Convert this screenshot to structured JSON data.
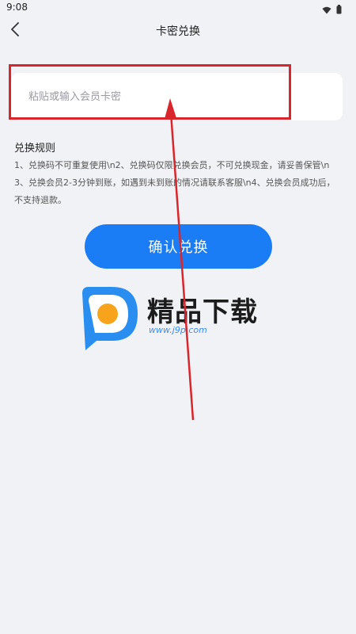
{
  "status_bar": {
    "time": "9:08",
    "icons": [
      "wifi-icon",
      "battery-icon"
    ]
  },
  "header": {
    "title": "卡密兑换",
    "back_icon": "chevron-left-icon"
  },
  "card_input": {
    "value": "",
    "placeholder": "粘贴或输入会员卡密"
  },
  "rules": {
    "title": "兑换规则",
    "text": "1、兑换码不可重复使用\\n2、兑换码仅限兑换会员，不可兑换现金，请妥善保管\\n3、兑换会员2-3分钟到账，如遇到未到账的情况请联系客服\\n4、兑换会员成功后，不支持退款。"
  },
  "confirm_button": {
    "label": "确认兑换"
  },
  "watermark": {
    "brand": "精品下载",
    "url": "www.j9p.com"
  },
  "colors": {
    "background": "#f1f2f6",
    "accent": "#1a7df5",
    "annotation_red": "#d9262c"
  }
}
